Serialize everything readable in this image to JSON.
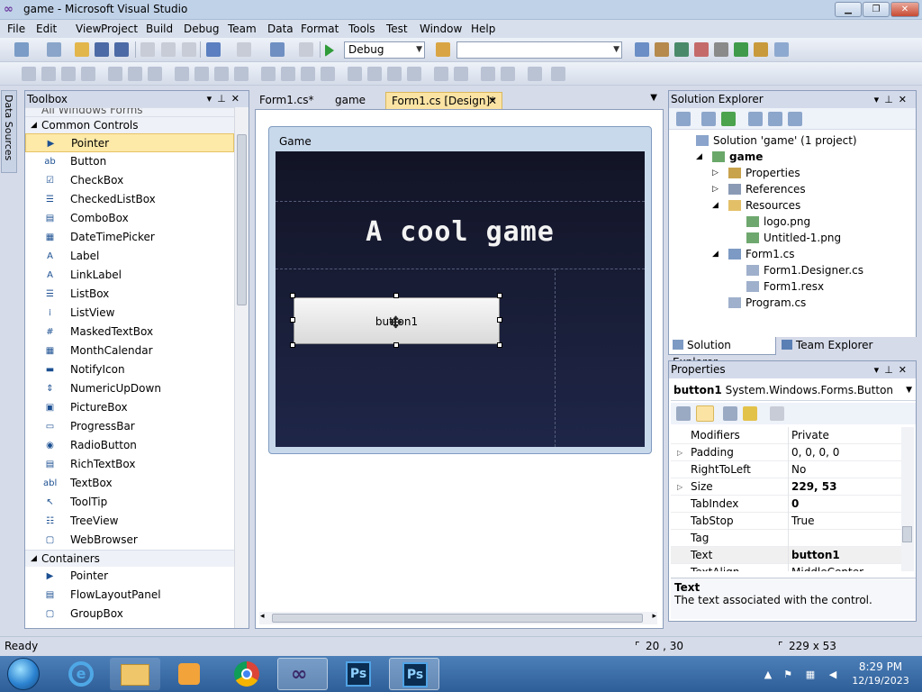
{
  "window": {
    "title": "game - Microsoft Visual Studio",
    "min_glyph": "▁",
    "max_glyph": "❐",
    "close_glyph": "✕"
  },
  "menu": [
    "File",
    "Edit",
    "View",
    "Project",
    "Build",
    "Debug",
    "Team",
    "Data",
    "Format",
    "Tools",
    "Test",
    "Window",
    "Help"
  ],
  "toolbar": {
    "config": "Debug",
    "platform": ""
  },
  "datasources": {
    "label": "Data Sources"
  },
  "toolbox": {
    "title": "Toolbox",
    "cut_group": "All Windows Forms",
    "group_common": "Common Controls",
    "common": [
      {
        "label": "Pointer",
        "icon": "▶"
      },
      {
        "label": "Button",
        "icon": "ab"
      },
      {
        "label": "CheckBox",
        "icon": "☑"
      },
      {
        "label": "CheckedListBox",
        "icon": "☰"
      },
      {
        "label": "ComboBox",
        "icon": "▤"
      },
      {
        "label": "DateTimePicker",
        "icon": "▦"
      },
      {
        "label": "Label",
        "icon": "A"
      },
      {
        "label": "LinkLabel",
        "icon": "A"
      },
      {
        "label": "ListBox",
        "icon": "☰"
      },
      {
        "label": "ListView",
        "icon": "⁞"
      },
      {
        "label": "MaskedTextBox",
        "icon": "#"
      },
      {
        "label": "MonthCalendar",
        "icon": "▦"
      },
      {
        "label": "NotifyIcon",
        "icon": "▬"
      },
      {
        "label": "NumericUpDown",
        "icon": "⇕"
      },
      {
        "label": "PictureBox",
        "icon": "▣"
      },
      {
        "label": "ProgressBar",
        "icon": "▭"
      },
      {
        "label": "RadioButton",
        "icon": "◉"
      },
      {
        "label": "RichTextBox",
        "icon": "▤"
      },
      {
        "label": "TextBox",
        "icon": "abl"
      },
      {
        "label": "ToolTip",
        "icon": "↖"
      },
      {
        "label": "TreeView",
        "icon": "☷"
      },
      {
        "label": "WebBrowser",
        "icon": "▢"
      }
    ],
    "group_containers": "Containers",
    "containers": [
      {
        "label": "Pointer",
        "icon": "▶"
      },
      {
        "label": "FlowLayoutPanel",
        "icon": "▤"
      },
      {
        "label": "GroupBox",
        "icon": "▢"
      }
    ]
  },
  "tabs": [
    {
      "label": "Form1.cs*"
    },
    {
      "label": "game"
    },
    {
      "label": "Form1.cs [Design]*"
    }
  ],
  "designer": {
    "form_title": "Game",
    "game_title": "A cool game",
    "button_text": "button1",
    "move_glyph": "✥"
  },
  "solution_explorer": {
    "title": "Solution Explorer",
    "items": [
      {
        "label": "Solution 'game' (1 project)"
      },
      {
        "label": "game"
      },
      {
        "label": "Properties"
      },
      {
        "label": "References"
      },
      {
        "label": "Resources"
      },
      {
        "label": "logo.png"
      },
      {
        "label": "Untitled-1.png"
      },
      {
        "label": "Form1.cs"
      },
      {
        "label": "Form1.Designer.cs"
      },
      {
        "label": "Form1.resx"
      },
      {
        "label": "Program.cs"
      }
    ],
    "tab_solution": "Solution Explorer",
    "tab_team": "Team Explorer"
  },
  "properties": {
    "title": "Properties",
    "object_name": "button1",
    "object_type": "System.Windows.Forms.Button",
    "rows": [
      {
        "name": "Modifiers",
        "value": "Private"
      },
      {
        "name": "Padding",
        "value": "0, 0, 0, 0"
      },
      {
        "name": "RightToLeft",
        "value": "No"
      },
      {
        "name": "Size",
        "value": "229, 53"
      },
      {
        "name": "TabIndex",
        "value": "0"
      },
      {
        "name": "TabStop",
        "value": "True"
      },
      {
        "name": "Tag",
        "value": ""
      },
      {
        "name": "Text",
        "value": "button1"
      },
      {
        "name": "TextAlign",
        "value": "MiddleCenter"
      }
    ],
    "desc_title": "Text",
    "desc_text": "The text associated with the control."
  },
  "status": {
    "ready": "Ready",
    "position": "20 , 30",
    "size": "229 x 53"
  },
  "taskbar": {
    "time": "8:29 PM",
    "date": "12/19/2023",
    "ps_label": "Ps"
  },
  "colors": {
    "accent_tab": "#fbe3a4",
    "selection": "#fde9a8",
    "form_bg": "#1a1f3a"
  }
}
